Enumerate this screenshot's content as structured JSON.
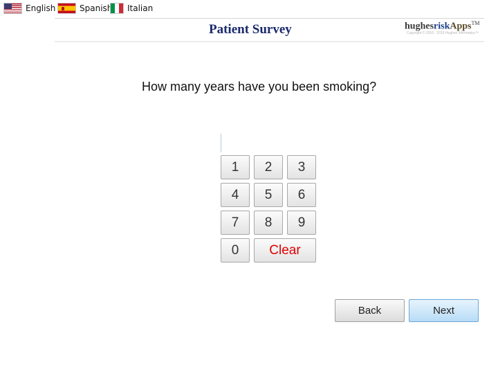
{
  "languages": [
    {
      "label": "English",
      "flag": "us-flag-icon"
    },
    {
      "label": "Spanish",
      "flag": "spain-flag-icon"
    },
    {
      "label": "Italian",
      "flag": "italy-flag-icon"
    }
  ],
  "header": {
    "title": "Patient Survey",
    "brand": {
      "part1": "hughes",
      "part2": "risk",
      "part3": "Apps",
      "tm": "TM"
    },
    "copyright": "Copyright © 2016 - 2016 Hughes Informatics™"
  },
  "question": {
    "text": "How many years have you been smoking?",
    "answer_value": ""
  },
  "keypad": {
    "keys": [
      "1",
      "2",
      "3",
      "4",
      "5",
      "6",
      "7",
      "8",
      "9",
      "0"
    ],
    "clear_label": "Clear"
  },
  "navigation": {
    "back_label": "Back",
    "next_label": "Next"
  },
  "colors": {
    "title": "#1a2a6c",
    "clear_text": "#e00000",
    "next_button": "#b7dcf6"
  }
}
